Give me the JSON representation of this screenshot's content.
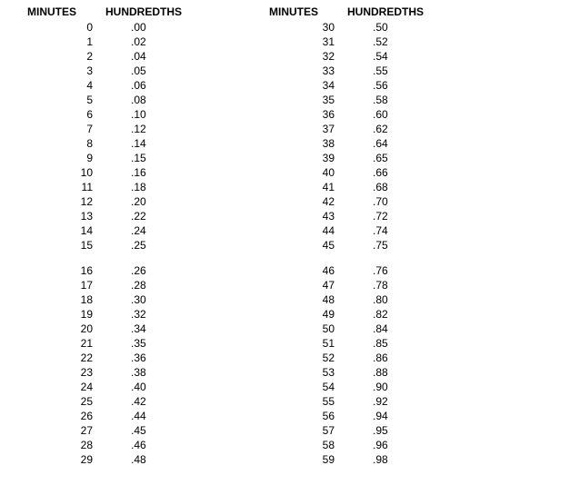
{
  "headers": {
    "minutes": "MINUTES",
    "hundredths": "HUNDREDTHS"
  },
  "left": {
    "block1": [
      {
        "m": "0",
        "h": ".00"
      },
      {
        "m": "1",
        "h": ".02"
      },
      {
        "m": "2",
        "h": ".04"
      },
      {
        "m": "3",
        "h": ".05"
      },
      {
        "m": "4",
        "h": ".06"
      },
      {
        "m": "5",
        "h": ".08"
      },
      {
        "m": "6",
        "h": ".10"
      },
      {
        "m": "7",
        "h": ".12"
      },
      {
        "m": "8",
        "h": ".14"
      },
      {
        "m": "9",
        "h": ".15"
      },
      {
        "m": "10",
        "h": ".16"
      },
      {
        "m": "11",
        "h": ".18"
      },
      {
        "m": "12",
        "h": ".20"
      },
      {
        "m": "13",
        "h": ".22"
      },
      {
        "m": "14",
        "h": ".24"
      },
      {
        "m": "15",
        "h": ".25"
      }
    ],
    "block2": [
      {
        "m": "16",
        "h": ".26"
      },
      {
        "m": "17",
        "h": ".28"
      },
      {
        "m": "18",
        "h": ".30"
      },
      {
        "m": "19",
        "h": ".32"
      },
      {
        "m": "20",
        "h": ".34"
      },
      {
        "m": "21",
        "h": ".35"
      },
      {
        "m": "22",
        "h": ".36"
      },
      {
        "m": "23",
        "h": ".38"
      },
      {
        "m": "24",
        "h": ".40"
      },
      {
        "m": "25",
        "h": ".42"
      },
      {
        "m": "26",
        "h": ".44"
      },
      {
        "m": "27",
        "h": ".45"
      },
      {
        "m": "28",
        "h": ".46"
      },
      {
        "m": "29",
        "h": ".48"
      }
    ]
  },
  "right": {
    "block1": [
      {
        "m": "30",
        "h": ".50"
      },
      {
        "m": "31",
        "h": ".52"
      },
      {
        "m": "32",
        "h": ".54"
      },
      {
        "m": "33",
        "h": ".55"
      },
      {
        "m": "34",
        "h": ".56"
      },
      {
        "m": "35",
        "h": ".58"
      },
      {
        "m": "36",
        "h": ".60"
      },
      {
        "m": "37",
        "h": ".62"
      },
      {
        "m": "38",
        "h": ".64"
      },
      {
        "m": "39",
        "h": ".65"
      },
      {
        "m": "40",
        "h": ".66"
      },
      {
        "m": "41",
        "h": ".68"
      },
      {
        "m": "42",
        "h": ".70"
      },
      {
        "m": "43",
        "h": ".72"
      },
      {
        "m": "44",
        "h": ".74"
      },
      {
        "m": "45",
        "h": ".75"
      }
    ],
    "block2": [
      {
        "m": "46",
        "h": ".76"
      },
      {
        "m": "47",
        "h": ".78"
      },
      {
        "m": "48",
        "h": ".80"
      },
      {
        "m": "49",
        "h": ".82"
      },
      {
        "m": "50",
        "h": ".84"
      },
      {
        "m": "51",
        "h": ".85"
      },
      {
        "m": "52",
        "h": ".86"
      },
      {
        "m": "53",
        "h": ".88"
      },
      {
        "m": "54",
        "h": ".90"
      },
      {
        "m": "55",
        "h": ".92"
      },
      {
        "m": "56",
        "h": ".94"
      },
      {
        "m": "57",
        "h": ".95"
      },
      {
        "m": "58",
        "h": ".96"
      },
      {
        "m": "59",
        "h": ".98"
      }
    ]
  }
}
